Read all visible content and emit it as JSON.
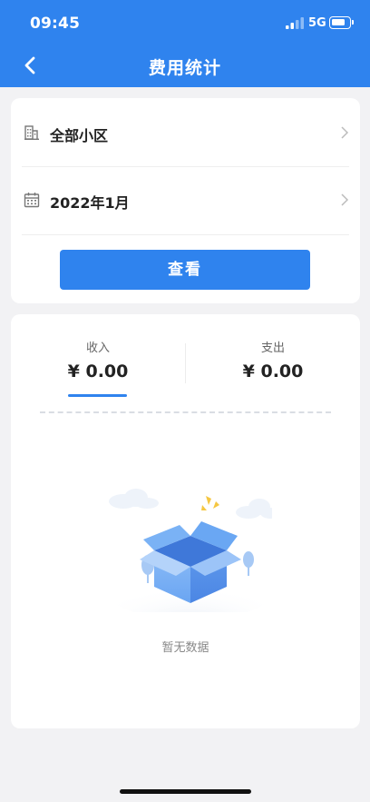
{
  "status_bar": {
    "time": "09:45",
    "network": "5G",
    "icons": [
      "signal-icon",
      "battery-icon"
    ]
  },
  "nav": {
    "title": "费用统计",
    "back_icon": "chevron-left-icon"
  },
  "filter": {
    "community": {
      "label": "全部小区",
      "icon": "building-icon"
    },
    "month": {
      "label": "2022年1月",
      "icon": "calendar-icon"
    },
    "query_button": "查看"
  },
  "stats": {
    "income": {
      "label": "收入",
      "value": "¥ 0.00"
    },
    "expense": {
      "label": "支出",
      "value": "¥ 0.00"
    },
    "active_tab": "income"
  },
  "empty_state": {
    "text": "暂无数据",
    "illustration": "open-box-illustration"
  },
  "colors": {
    "primary": "#2f83ee",
    "background": "#f2f2f4",
    "card": "#ffffff"
  }
}
